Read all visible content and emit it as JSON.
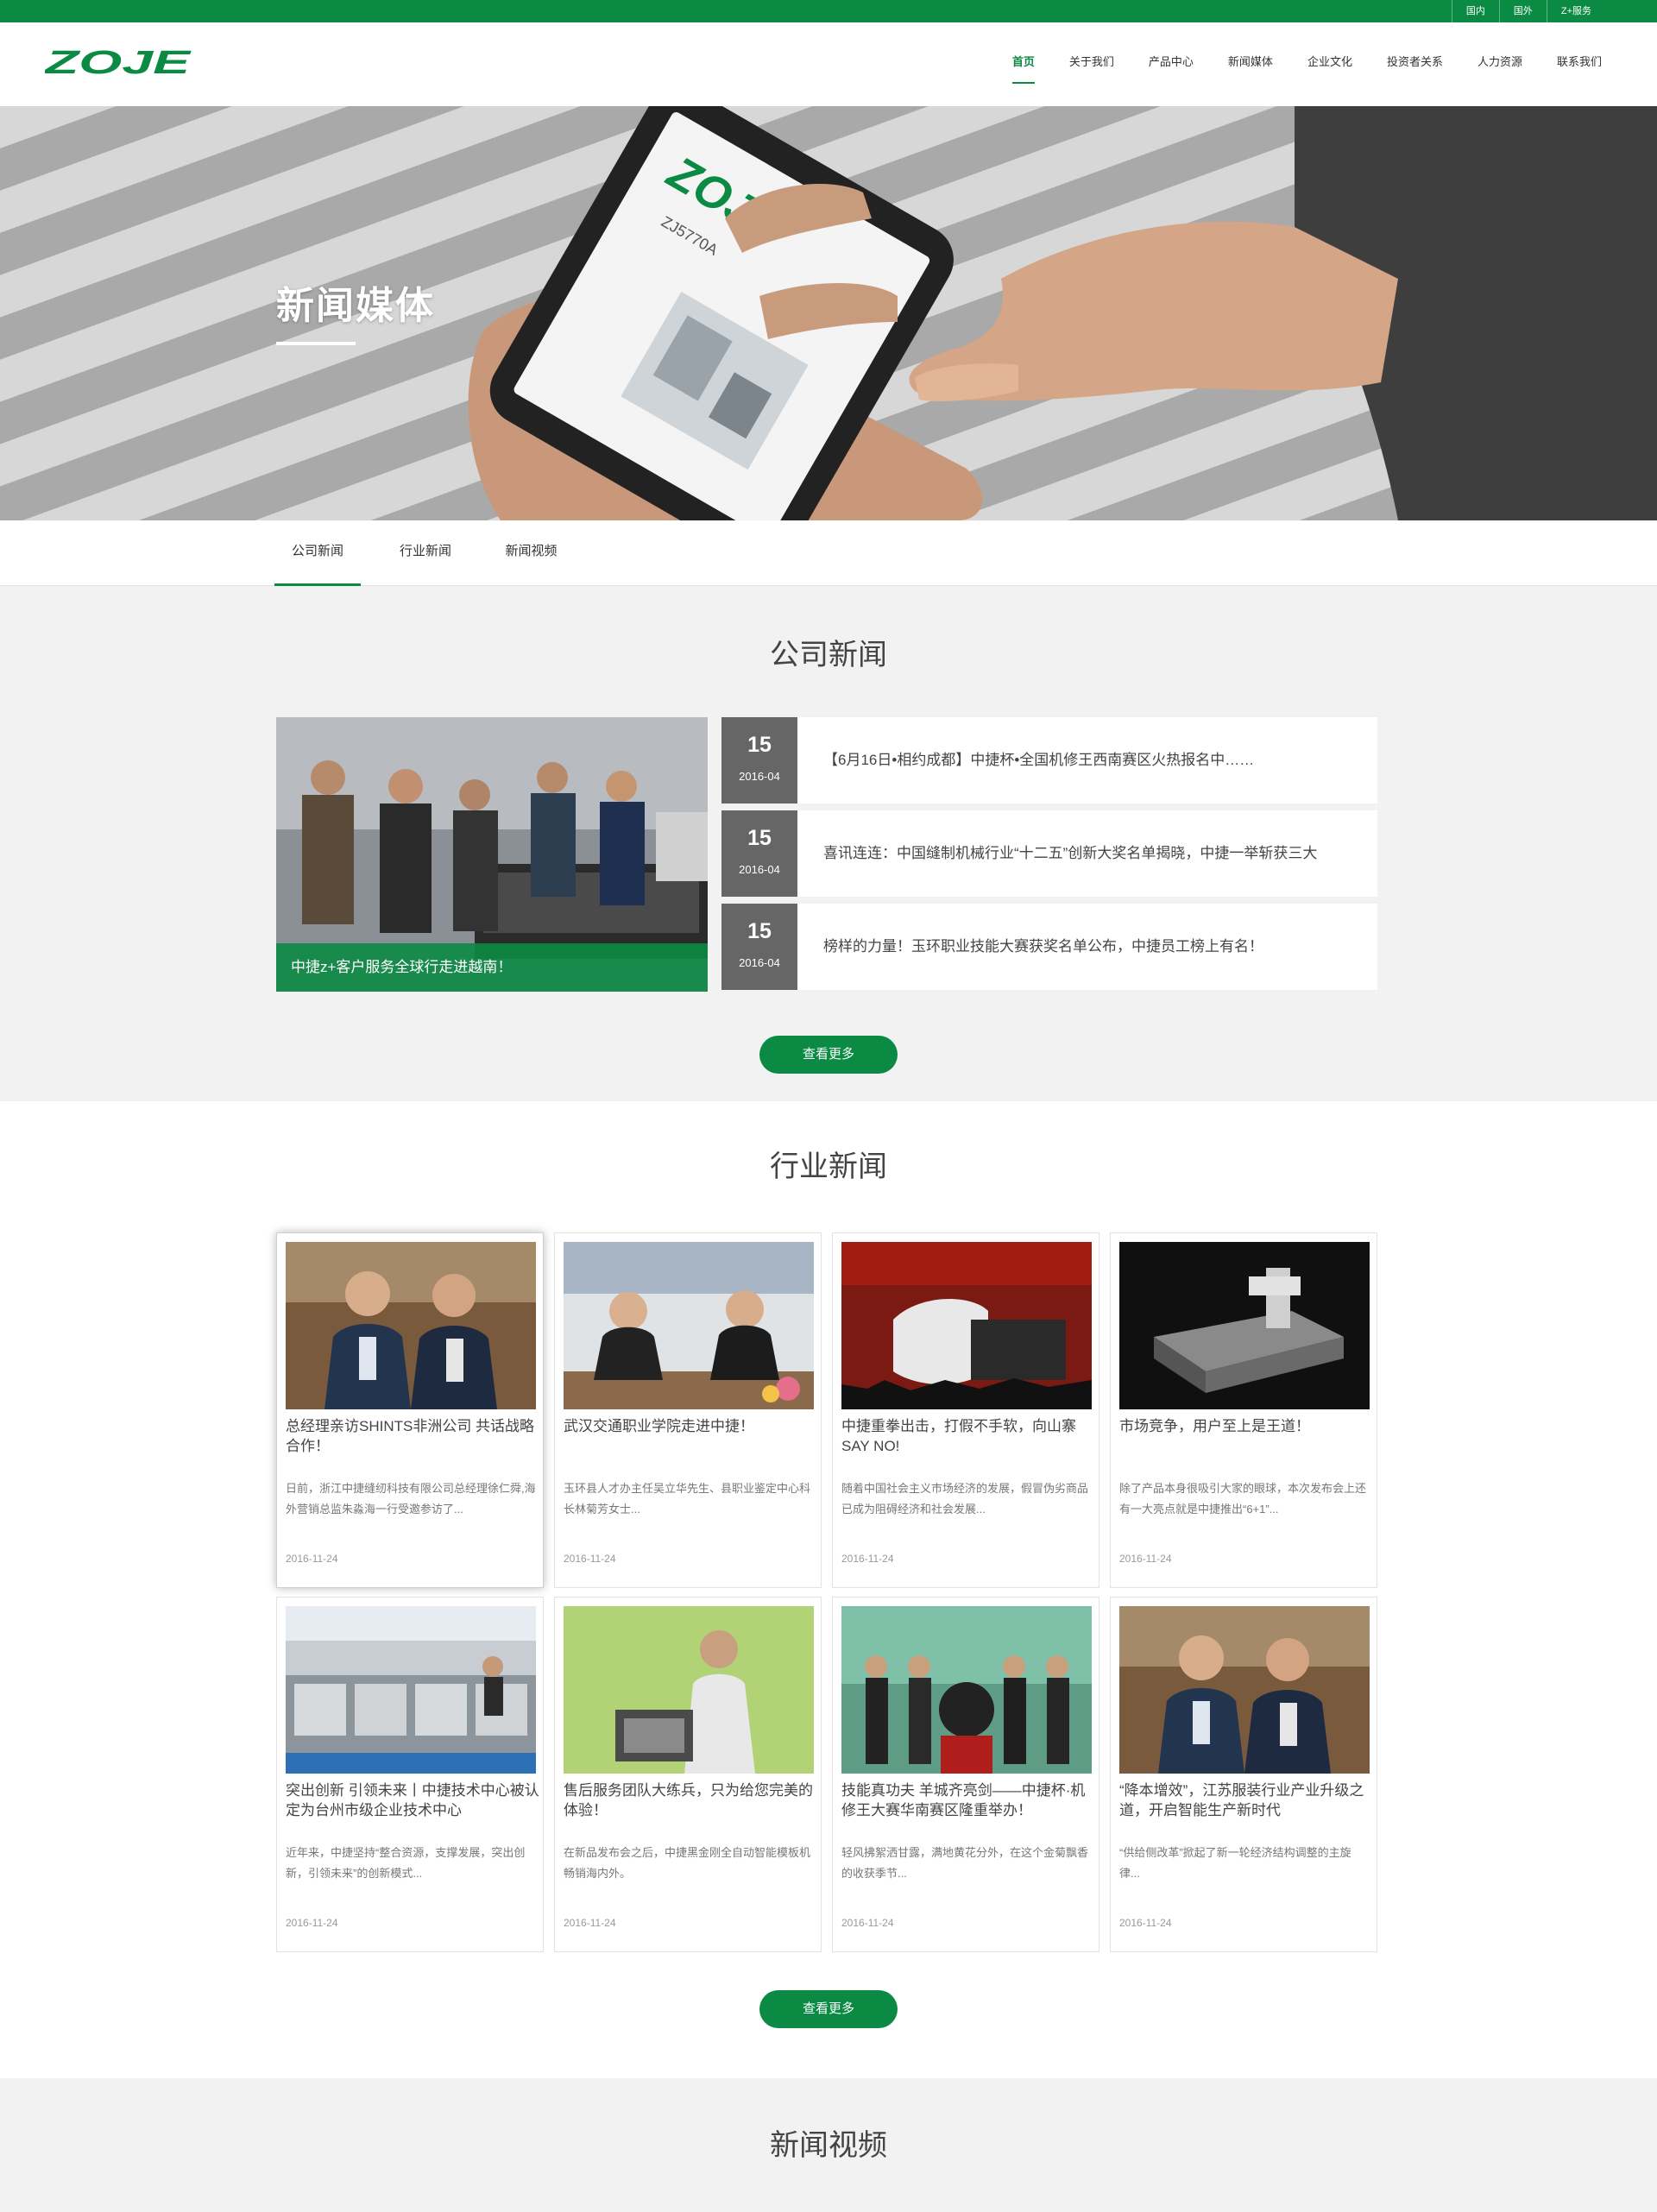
{
  "topbar": {
    "links": [
      "国内",
      "国外",
      "Z+服务"
    ]
  },
  "header": {
    "logo_text": "ZOJE",
    "nav": [
      "首页",
      "关于我们",
      "产品中心",
      "新闻媒体",
      "企业文化",
      "投资者关系",
      "人力资源",
      "联系我们"
    ]
  },
  "hero": {
    "title": "新闻媒体"
  },
  "subtabs": [
    "公司新闻",
    "行业新闻",
    "新闻视频"
  ],
  "company": {
    "title": "公司新闻",
    "feature_caption": "中捷z+客户服务全球行走进越南！",
    "items": [
      {
        "day": "15",
        "ym": "2016-04",
        "text": "【6月16日•相约成都】中捷杯•全国机修王西南赛区火热报名中……"
      },
      {
        "day": "15",
        "ym": "2016-04",
        "text": "喜讯连连：中国缝制机械行业“十二五”创新大奖名单揭晓，中捷一举斩获三大"
      },
      {
        "day": "15",
        "ym": "2016-04",
        "text": "榜样的力量！玉环职业技能大赛获奖名单公布，中捷员工榜上有名！"
      }
    ],
    "more_label": "查看更多"
  },
  "industry": {
    "title": "行业新闻",
    "cards": [
      {
        "title": "总经理亲访SHINTS非洲公司 共话战略合作！",
        "desc": "日前，浙江中捷缝纫科技有限公司总经理徐仁舜,海外营销总监朱淼海一行受邀参访了...",
        "date": "2016-11-24",
        "img": "two-men-icon"
      },
      {
        "title": "武汉交通职业学院走进中捷！",
        "desc": "玉环县人才办主任吴立华先生、县职业鉴定中心科长林菊芳女士...",
        "date": "2016-11-24",
        "img": "meeting-icon"
      },
      {
        "title": "中捷重拳出击，打假不手软，向山寨SAY NO!",
        "desc": "随着中国社会主义市场经济的发展，假冒伪劣商品已成为阻碍经济和社会发展...",
        "date": "2016-11-24",
        "img": "anti-fake-icon"
      },
      {
        "title": "市场竞争，用户至上是王道！",
        "desc": "除了产品本身很吸引大家的眼球，本次发布会上还有一大亮点就是中捷推出“6+1”...",
        "date": "2016-11-24",
        "img": "machine-icon"
      },
      {
        "title": "突出创新 引领未来丨中捷技术中心被认定为台州市级企业技术中心",
        "desc": "近年来，中捷坚持“整合资源，支撑发展，突出创新，引领未来”的创新模式...",
        "date": "2016-11-24",
        "img": "factory-icon"
      },
      {
        "title": "售后服务团队大练兵，只为给您完美的体验！",
        "desc": "在新品发布会之后，中捷黑金刚全自动智能模板机畅销海内外。",
        "date": "2016-11-24",
        "img": "presenter-icon"
      },
      {
        "title": "技能真功夫 羊城齐亮剑——中捷杯·机修王大赛华南赛区隆重举办！",
        "desc": "轻风拂絮洒甘露，满地黄花分外，在这个金菊飘香的收获季节...",
        "date": "2016-11-24",
        "img": "ceremony-icon"
      },
      {
        "title": "“降本增效”，江苏服装行业产业升级之道，开启智能生产新时代",
        "desc": "“供给侧改革”掀起了新一轮经济结构调整的主旋律...",
        "date": "2016-11-24",
        "img": "two-men-icon"
      }
    ],
    "more_label": "查看更多"
  },
  "video": {
    "title": "新闻视频"
  },
  "phone_screen": {
    "model": "ZJ5770A",
    "brand": "ZOJE"
  },
  "colors": {
    "brand_green": "#0b8a43",
    "date_gray": "#666666",
    "section_bg": "#f2f2f2"
  }
}
